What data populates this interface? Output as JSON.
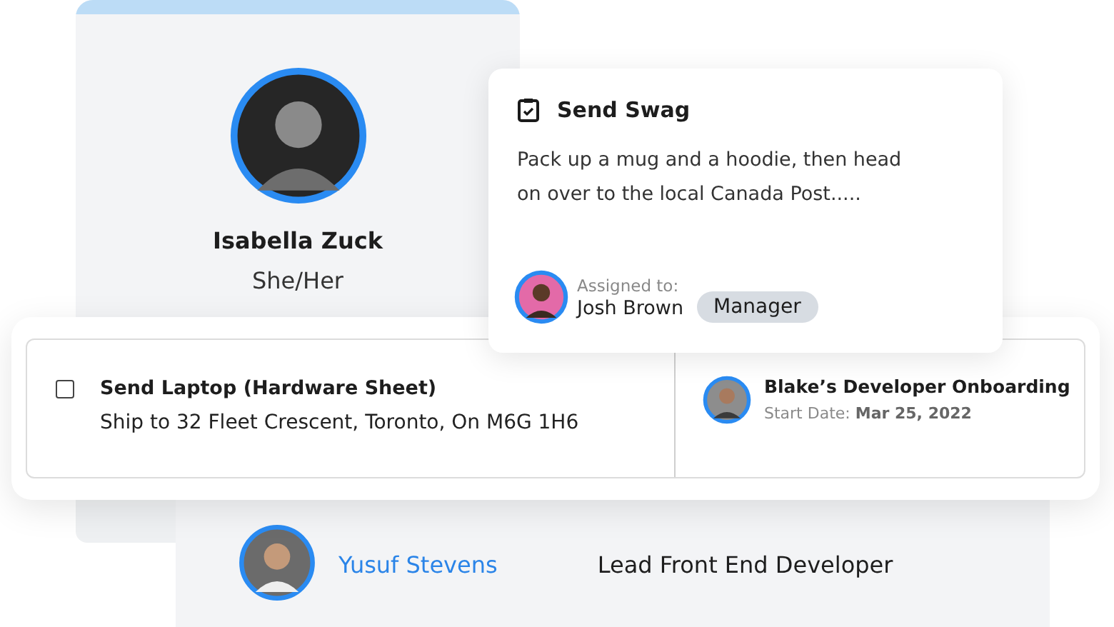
{
  "profile": {
    "name": "Isabella Zuck",
    "pronouns": "She/Her"
  },
  "task_card": {
    "title": "Send Swag",
    "description": "Pack up a mug and a hoodie, then head on over to the local Canada Post.....",
    "assignee_label": "Assigned to:",
    "assignee": "Josh Brown",
    "role": "Manager"
  },
  "laptop_task": {
    "checked": false,
    "title": "Send Laptop (Hardware Sheet)",
    "address": "Ship to 32 Fleet Crescent, Toronto, On M6G 1H6"
  },
  "onboarding": {
    "title": "Blake’s Developer Onboarding",
    "start_label": "Start Date:",
    "start_date": "Mar 25, 2022"
  },
  "person_row": {
    "name": "Yusuf Stevens",
    "job_title": "Lead Front End Developer"
  }
}
